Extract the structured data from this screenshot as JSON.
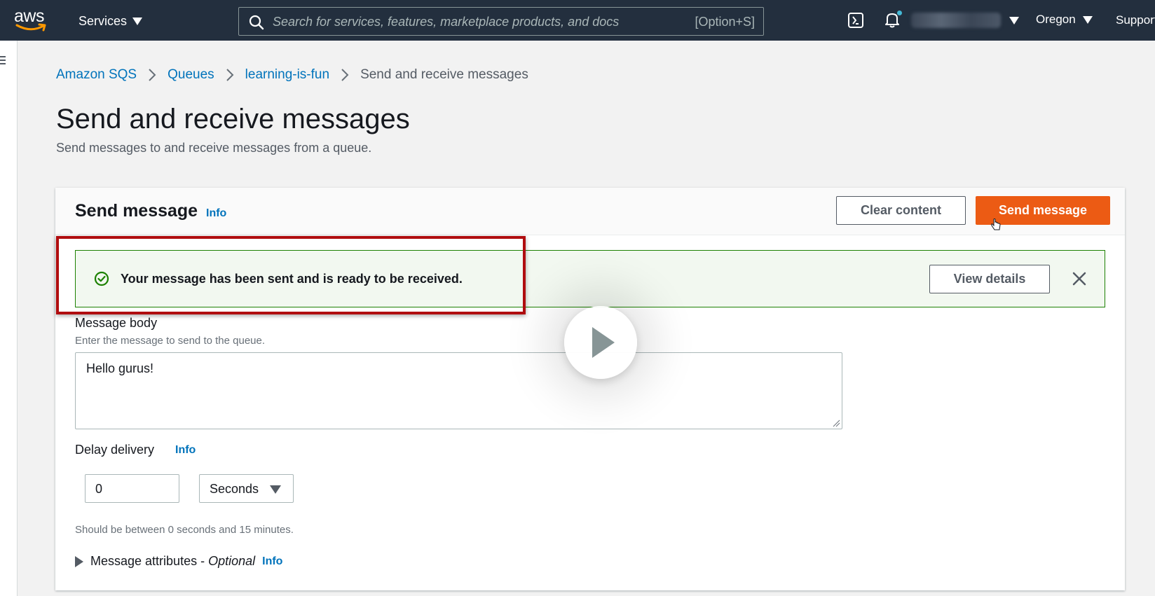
{
  "nav": {
    "logo_text": "aws",
    "services_label": "Services",
    "search_placeholder": "Search for services, features, marketplace products, and docs",
    "search_shortcut": "[Option+S]",
    "region": "Oregon",
    "support": "Support"
  },
  "breadcrumb": [
    {
      "label": "Amazon SQS"
    },
    {
      "label": "Queues"
    },
    {
      "label": "learning-is-fun"
    },
    {
      "label": "Send and receive messages"
    }
  ],
  "page": {
    "title": "Send and receive messages",
    "subtitle": "Send messages to and receive messages from a queue."
  },
  "panel": {
    "title": "Send message",
    "info": "Info",
    "clear_label": "Clear content",
    "send_label": "Send message"
  },
  "flash": {
    "message": "Your message has been sent and is ready to be received.",
    "details_label": "View details"
  },
  "form": {
    "body_label": "Message body",
    "body_desc": "Enter the message to send to the queue.",
    "body_value": "Hello gurus!",
    "delay_label": "Delay delivery",
    "delay_info": "Info",
    "delay_value": "0",
    "delay_unit": "Seconds",
    "delay_hint": "Should be between 0 seconds and 15 minutes.",
    "attributes_label": "Message attributes - ",
    "attributes_optional": "Optional",
    "attributes_info": "Info"
  },
  "colors": {
    "nav_bg": "#232f3e",
    "link": "#0073bb",
    "primary_button": "#ec5b14",
    "success_border": "#1d8102",
    "highlight": "#b00d0f"
  }
}
